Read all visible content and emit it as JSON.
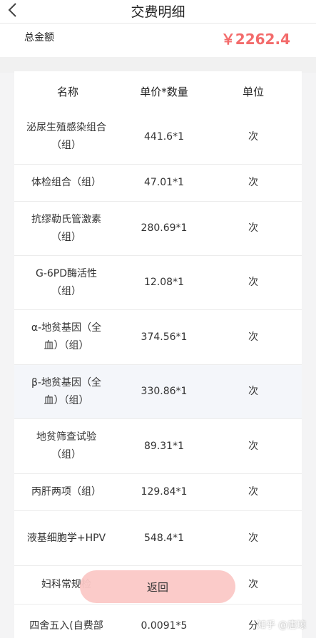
{
  "header": {
    "title": "交费明细"
  },
  "summary": {
    "total_label": "总金额",
    "total_value": "￥2262.4"
  },
  "table": {
    "columns": [
      "名称",
      "单价*数量",
      "单位"
    ],
    "rows": [
      {
        "name": "泌尿生殖感染组合（组）",
        "price_qty": "441.6*1",
        "unit": "次"
      },
      {
        "name": "体检组合（组）",
        "price_qty": "47.01*1",
        "unit": "次"
      },
      {
        "name": "抗缪勒氏管激素（组）",
        "price_qty": "280.69*1",
        "unit": "次"
      },
      {
        "name": "G-6PD酶活性（组）",
        "price_qty": "12.08*1",
        "unit": "次"
      },
      {
        "name": "α-地贫基因（全血）（组）",
        "price_qty": "374.56*1",
        "unit": "次"
      },
      {
        "name": "β-地贫基因（全血）（组）",
        "price_qty": "330.86*1",
        "unit": "次"
      },
      {
        "name": "地贫筛查试验（组）",
        "price_qty": "89.31*1",
        "unit": "次"
      },
      {
        "name": "丙肝两项（组）",
        "price_qty": "129.84*1",
        "unit": "次"
      },
      {
        "name": "液基细胞学+HPV",
        "price_qty": "548.4*1",
        "unit": "次"
      },
      {
        "name": "妇科常规检",
        "price_qty": "",
        "unit": "次"
      },
      {
        "name": "四舍五入(自费部",
        "price_qty": "0.0091*5",
        "unit": "分"
      }
    ]
  },
  "footer": {
    "back_label": "返回"
  },
  "watermark": {
    "text": "知乎 @唐琼"
  }
}
